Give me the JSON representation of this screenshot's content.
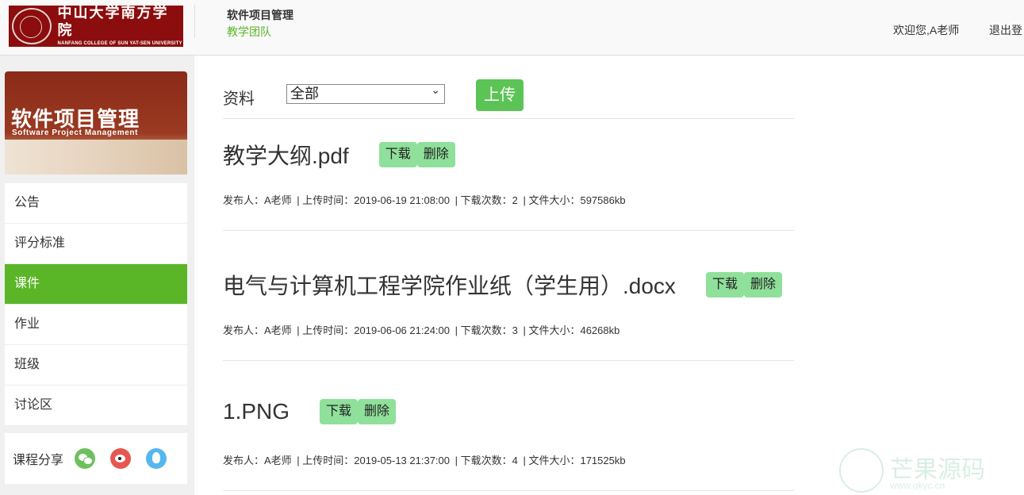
{
  "header": {
    "logo_cn": "中山大学南方学院",
    "logo_en": "NANFANG COLLEGE OF SUN YAT-SEN UNIVERSITY",
    "course_title": "软件项目管理",
    "team_link": "教学团队",
    "welcome": "欢迎您,A老师",
    "logout": "退出登"
  },
  "sidebar": {
    "banner_cn": "软件项目管理",
    "banner_en": "Software Project Management",
    "items": [
      {
        "label": "公告"
      },
      {
        "label": "评分标准"
      },
      {
        "label": "课件"
      },
      {
        "label": "作业"
      },
      {
        "label": "班级"
      },
      {
        "label": "讨论区"
      }
    ],
    "share_label": "课程分享"
  },
  "toolbar": {
    "label": "资料",
    "filter_value": "全部",
    "upload_label": "上传"
  },
  "files": [
    {
      "name": "教学大纲.pdf",
      "download": "下载",
      "delete": "删除",
      "publisher": "发布人：A老师",
      "upload_time": "| 上传时间：2019-06-19 21:08:00",
      "downloads": "| 下载次数：2",
      "size": "| 文件大小：597586kb"
    },
    {
      "name": "电气与计算机工程学院作业纸（学生用）.docx",
      "download": "下载",
      "delete": "删除",
      "publisher": "发布人：A老师",
      "upload_time": "| 上传时间：2019-06-06 21:24:00",
      "downloads": "| 下载次数：3",
      "size": "| 文件大小：46268kb"
    },
    {
      "name": "1.PNG",
      "download": "下载",
      "delete": "删除",
      "publisher": "发布人：A老师",
      "upload_time": "| 上传时间：2019-05-13 21:37:00",
      "downloads": "| 下载次数：4",
      "size": "| 文件大小：171525kb"
    }
  ],
  "watermark": {
    "text": "芒果源码",
    "url": "www.okyc.cn"
  },
  "colors": {
    "accent": "#5ab527",
    "upload": "#5cc356",
    "action": "#8fe09a",
    "brand": "#8b0d0d"
  },
  "icons": {
    "share": [
      "wechat-icon",
      "weibo-icon",
      "qq-icon"
    ]
  }
}
